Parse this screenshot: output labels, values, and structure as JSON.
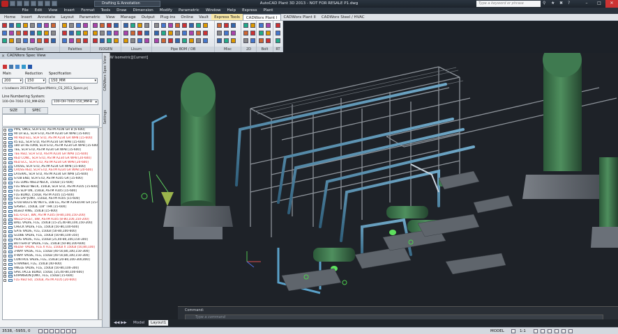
{
  "titlebar": {
    "workspace": "Drafting & Annotation",
    "title": "AutoCAD Plant 3D 2013 - NOT FOR RESALE    P1.dwg",
    "search_placeholder": "Type a keyword or phrase"
  },
  "menus": [
    "File",
    "Edit",
    "View",
    "Insert",
    "Format",
    "Tools",
    "Draw",
    "Dimension",
    "Modify",
    "Parametric",
    "Window",
    "Help",
    "Express",
    "Plant"
  ],
  "ribbon_tabs": [
    {
      "label": "Home",
      "state": "normal"
    },
    {
      "label": "Insert",
      "state": "normal"
    },
    {
      "label": "Annotate",
      "state": "normal"
    },
    {
      "label": "Layout",
      "state": "normal"
    },
    {
      "label": "Parametric",
      "state": "normal"
    },
    {
      "label": "View",
      "state": "normal"
    },
    {
      "label": "Manage",
      "state": "normal"
    },
    {
      "label": "Output",
      "state": "normal"
    },
    {
      "label": "Plug-ins",
      "state": "normal"
    },
    {
      "label": "Online",
      "state": "normal"
    },
    {
      "label": "Vault",
      "state": "normal"
    },
    {
      "label": "Express Tools",
      "state": "highlight"
    },
    {
      "label": "CADWorx Plant I",
      "state": "active"
    },
    {
      "label": "CADWorx Plant II",
      "state": "normal"
    },
    {
      "label": "CADWorx Steel / HVAC",
      "state": "normal"
    }
  ],
  "ribbon_panels": [
    "Setup Size/Spec",
    "Palettes",
    "ISOGEN",
    "LIsum",
    "Pipe BOM / DB",
    "Misc",
    "2D",
    "Bolt",
    "RT"
  ],
  "spec_view": {
    "caption": "CADWorx Spec View",
    "side_tabs": [
      "CADWorx Spec View",
      "Settings"
    ],
    "main_label": "Main",
    "reduction_label": "Reduction",
    "specification_label": "Specification",
    "main_value": "200",
    "reduction_value": "150",
    "specification_value": "150_MM",
    "spec_path": "c:\\cadworx 2013\\Plant\\Spec\\Metric_CS_2013_Specs.prj",
    "line_numbering_label": "Line Numbering System:",
    "line_number_left": "100-OH-7002-150_MM-B5D",
    "line_number_right": "100-OH-7002-150_MM-B",
    "size_header": "SIZE",
    "spec_header": "SPEC"
  },
  "parts": [
    {
      "text": "PIPE, SMLS, SCH STD, ASTM A106 GR B [6-600]",
      "red": false
    },
    {
      "text": "90 LR ELL, SCH STD, ASTM A234 GR WPB [15-600]",
      "red": false
    },
    {
      "text": "90 RED ELL, SCH STD, ASTM A234 GR WPB [15-600]",
      "red": true
    },
    {
      "text": "45 ELL, SCH STD, ASTM A234 GR WPB [15-600]",
      "red": false
    },
    {
      "text": "180 LR RETURN, SCH STD, ASTM A234 GR WPB [15-600]",
      "red": false
    },
    {
      "text": "TEE, SCH STD, ASTM A234 GR WPB [15-600]",
      "red": false
    },
    {
      "text": "TEE RED, SCH STD, ASTM A234 GR WPB [15-600]",
      "red": true
    },
    {
      "text": "RED CONC, SCH STD, ASTM A234 GR WPB [20-600]",
      "red": true
    },
    {
      "text": "RED ECC, SCH STD, ASTM A234 GR WPB [20-600]",
      "red": true
    },
    {
      "text": "CROSS, SCH STD, ASTM A234 GR WPB [15-600]",
      "red": false
    },
    {
      "text": "CROSS RED, SCH STD, ASTM A234 GR WPB [20-600]",
      "red": true
    },
    {
      "text": "LATERAL, SCH STD, ASTM A234 GR WPB [25-600]",
      "red": false
    },
    {
      "text": "STUB END, SCH STD, ASTM A105 GR [15-600]",
      "red": false
    },
    {
      "text": "FLG LONG WELD NECK, 150LB [15-600]",
      "red": false
    },
    {
      "text": "FLG WELD NECK, 150LB, SCH STD, ASTM A105 [15-600]",
      "red": false
    },
    {
      "text": "FLG SLIP ON, 150LB, ASTM A105 [15-600]",
      "red": false
    },
    {
      "text": "FLG BLIND, 150LB, ASTM A105 [15-600]",
      "red": false
    },
    {
      "text": "FLG LAP JOINT, 150LB, ASTM A105 [15-600]",
      "red": false
    },
    {
      "text": "STUD BOLTS W/ NUTS, 108 LG, ASTM A193/194 GR [15-600]",
      "red": false
    },
    {
      "text": "GASKET, 150LB, 1/8\" THK [15-600]",
      "red": false
    },
    {
      "text": "BLEED RING, 150LB [15-600]",
      "red": false
    },
    {
      "text": "ELL-O-LET, BW, ASTM A105 [8-80,100,150-200]",
      "red": true
    },
    {
      "text": "WELD-O-LET, BW, ASTM A105 [8-80,100,150-200]",
      "red": true
    },
    {
      "text": "BALL VALVE, FLG, 150LB [15-25,40-80,100,150-200]",
      "red": false
    },
    {
      "text": "CHECK VALVE, FLG, 150LB [50-80,100-600]",
      "red": false
    },
    {
      "text": "GATE VALVE, FLG, 150LB [50-80,100-600]",
      "red": false
    },
    {
      "text": "GLOBE VALVE, FLG, 150LB [50-80,100-350]",
      "red": false
    },
    {
      "text": "PLUG VALVE, FLG, 150LB [25,40-80,100,150-300]",
      "red": false
    },
    {
      "text": "BUTTERFLY VALVE, FLG, 150LB [50-80,100-600]",
      "red": false
    },
    {
      "text": "RELIEF VALVE, FLG X FLG, 150LB X 150LB [50,80,100]",
      "red": true
    },
    {
      "text": "3-WAY VALVE, FLG, 150LB [40-50,80,100,150-300]",
      "red": false
    },
    {
      "text": "4-WAY VALVE, FLG, 150LB [40-50,80,100,150-300]",
      "red": false
    },
    {
      "text": "CONTROL VALVE, FLG, 150LB [20-80,100-300,400]",
      "red": false
    },
    {
      "text": "STRAINER, FLG, 150LB [40-600]",
      "red": false
    },
    {
      "text": "ANGLE VALVE, FLG, 150LB [50-80,100-300]",
      "red": false
    },
    {
      "text": "SPECTACLE BLIND, 150LB, [25,40-80,100-600]",
      "red": false
    },
    {
      "text": "EXPANSION JOINT, FLG, 150LB [15-600]",
      "red": false
    },
    {
      "text": "FLG RED SO, 150LB, ASTM A105 [20-600]",
      "red": true
    }
  ],
  "viewport": {
    "label": "[-][SW Isometric][Current]"
  },
  "command": {
    "label": "Command:",
    "placeholder": "Type a command"
  },
  "layout_tabs": {
    "model": "Model",
    "layout1": "Layout1"
  },
  "status": {
    "coords": "3538, -5955, 0",
    "model": "MODEL",
    "scale": "1:1"
  }
}
